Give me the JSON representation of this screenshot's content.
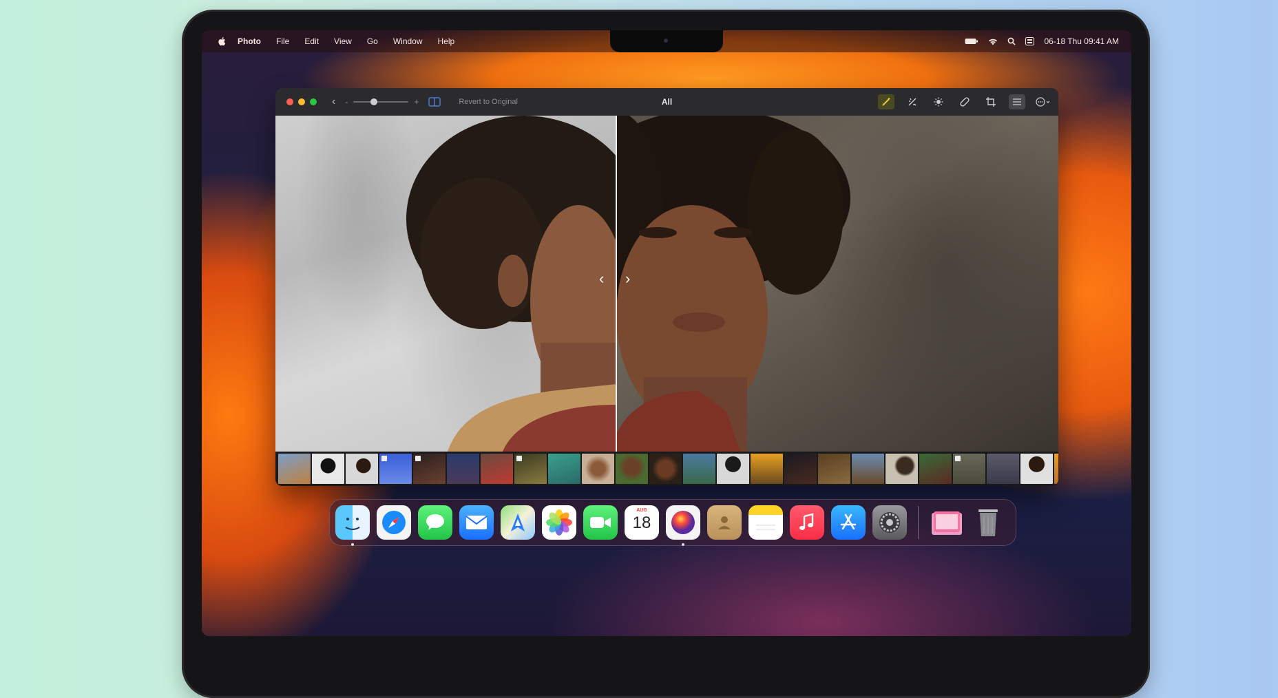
{
  "menubar": {
    "app_name": "Photo",
    "menu_items": [
      "File",
      "Edit",
      "View",
      "Go",
      "Window",
      "Help"
    ],
    "datetime": "06-18 Thu 09:41 AM"
  },
  "window": {
    "revert_label": "Revert to Original",
    "title": "All",
    "zoom_level": 0.35
  },
  "dock": {
    "calendar": {
      "month": "AUG",
      "day": "18"
    },
    "apps": [
      "Finder",
      "Safari",
      "Messages",
      "Mail",
      "Maps",
      "Photos",
      "FaceTime",
      "Calendar",
      "Siri",
      "Contacts",
      "Notes",
      "Music",
      "App Store",
      "System Settings",
      "Downloads",
      "Trash"
    ]
  },
  "colors": {
    "traffic_red": "#ff5f57",
    "traffic_yellow": "#febc2e",
    "traffic_green": "#28c840",
    "accent_orange": "#f26b0a"
  }
}
